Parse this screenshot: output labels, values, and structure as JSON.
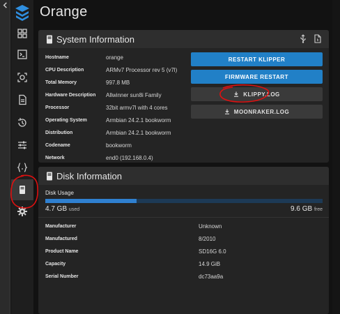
{
  "app": {
    "title": "Orange"
  },
  "colors": {
    "accent": "#2180c7",
    "annotation": "#e01010"
  },
  "sidebar": {
    "items": [
      {
        "icon": "dashboard-icon"
      },
      {
        "icon": "console-icon"
      },
      {
        "icon": "webcam-icon"
      },
      {
        "icon": "files-icon"
      },
      {
        "icon": "history-icon"
      },
      {
        "icon": "tune-icon"
      },
      {
        "icon": "config-icon"
      },
      {
        "icon": "system-icon"
      },
      {
        "icon": "settings-icon"
      }
    ]
  },
  "system_info": {
    "title": "System Information",
    "rows": [
      {
        "label": "Hostname",
        "value": "orange"
      },
      {
        "label": "CPU Description",
        "value": "ARMv7 Processor rev 5 (v7l)"
      },
      {
        "label": "Total Memory",
        "value": "997.8 MB"
      },
      {
        "label": "Hardware Description",
        "value": "Allwinner sun8i Family"
      },
      {
        "label": "Processor",
        "value": "32bit armv7l with 4 cores"
      },
      {
        "label": "Operating System",
        "value": "Armbian 24.2.1 bookworm"
      },
      {
        "label": "Distribution",
        "value": "Armbian 24.2.1 bookworm"
      },
      {
        "label": "Codename",
        "value": "bookworm"
      },
      {
        "label": "Network",
        "value": "end0 (192.168.0.4)"
      }
    ],
    "buttons": {
      "restart_klipper": "RESTART KLIPPER",
      "firmware_restart": "FIRMWARE RESTART",
      "klippy_log": "KLIPPY.LOG",
      "moonraker_log": "MOONRAKER.LOG"
    }
  },
  "disk_info": {
    "title": "Disk Information",
    "usage_label": "Disk Usage",
    "used_value": "4.7 GB",
    "used_suffix": "used",
    "free_value": "9.6 GB",
    "free_suffix": "free",
    "used_fraction": 0.33,
    "rows": [
      {
        "label": "Manufacturer",
        "value": "Unknown"
      },
      {
        "label": "Manufactured",
        "value": "8/2010"
      },
      {
        "label": "Product Name",
        "value": "SD16G 6.0"
      },
      {
        "label": "Capacity",
        "value": "14.9 GiB"
      },
      {
        "label": "Serial Number",
        "value": "dc73aa9a"
      }
    ]
  }
}
